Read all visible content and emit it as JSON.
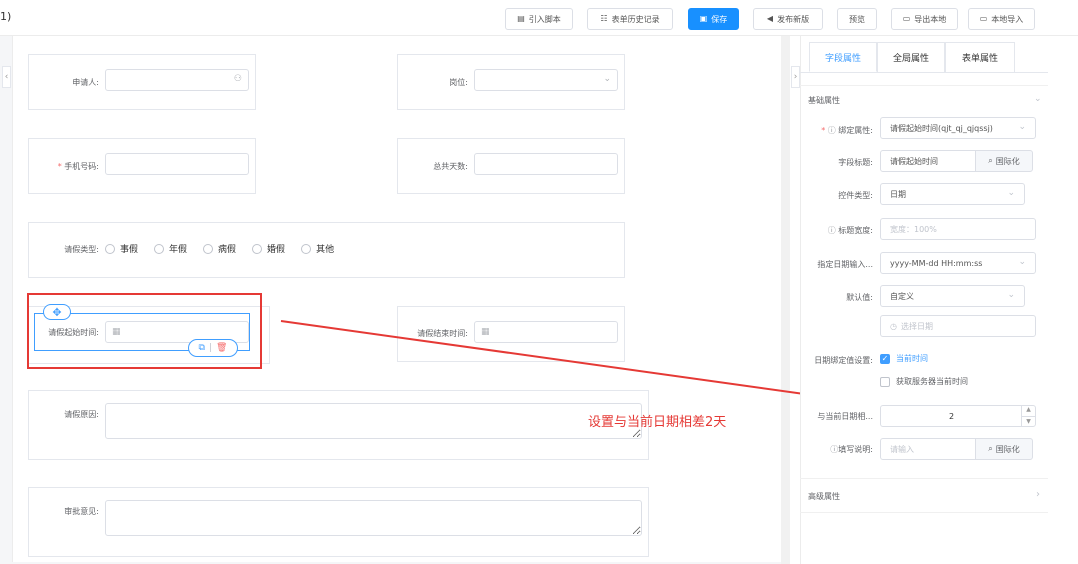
{
  "window": {
    "corner_text": "1)"
  },
  "toolbar": {
    "buttons": [
      {
        "label": "引入脚本",
        "icon": "script-icon"
      },
      {
        "label": "表单历史记录",
        "icon": "history-icon"
      },
      {
        "label": "保存",
        "icon": "save-icon"
      },
      {
        "label": "发布新版",
        "icon": "send-icon"
      },
      {
        "label": "预览",
        "icon": ""
      },
      {
        "label": "导出本地",
        "icon": "folder-icon"
      },
      {
        "label": "本地导入",
        "icon": "folder-icon"
      }
    ],
    "primary_color": "#1890ff"
  },
  "form": {
    "applicant_label": "申请人:",
    "position_label": "岗位:",
    "phone_label": "手机号码:",
    "total_days_label": "总共天数:",
    "leave_type_label": "请假类型:",
    "leave_types": [
      "事假",
      "年假",
      "病假",
      "婚假",
      "其他"
    ],
    "start_time_label": "请假起始时间:",
    "end_time_label": "请假结束时间:",
    "reason_label": "请假原因:",
    "approval_label": "审批意见:",
    "required_mark": "*"
  },
  "annotation": {
    "text": "设置与当前日期相差2天",
    "color": "#e53935"
  },
  "props": {
    "tabs": [
      "字段属性",
      "全局属性",
      "表单属性"
    ],
    "active_tab": 0,
    "basic_section": "基础属性",
    "advanced_section": "高级属性",
    "bind_label": "绑定属性:",
    "bind_value": "请假起始时间(qjt_qj_qjqssj)",
    "field_title_label": "字段标题:",
    "field_title_value": "请假起始时间",
    "i18n_label": "国际化",
    "control_type_label": "控件类型:",
    "control_type_value": "日期",
    "title_width_label": "标题宽度:",
    "title_width_placeholder": "宽度：100%",
    "date_format_label": "指定日期输入...",
    "date_format_value": "yyyy-MM-dd HH:mm:ss",
    "default_label": "默认值:",
    "default_value": "自定义",
    "date_placeholder": "选择日期",
    "date_bind_label": "日期绑定值设置:",
    "current_time_label": "当前时间",
    "server_time_label": "获取服务器当前时间",
    "diff_label": "与当前日期相...",
    "diff_value": "2",
    "fill_note_label": "填写说明:",
    "fill_note_placeholder": "请输入",
    "accent_color": "#409eff"
  }
}
